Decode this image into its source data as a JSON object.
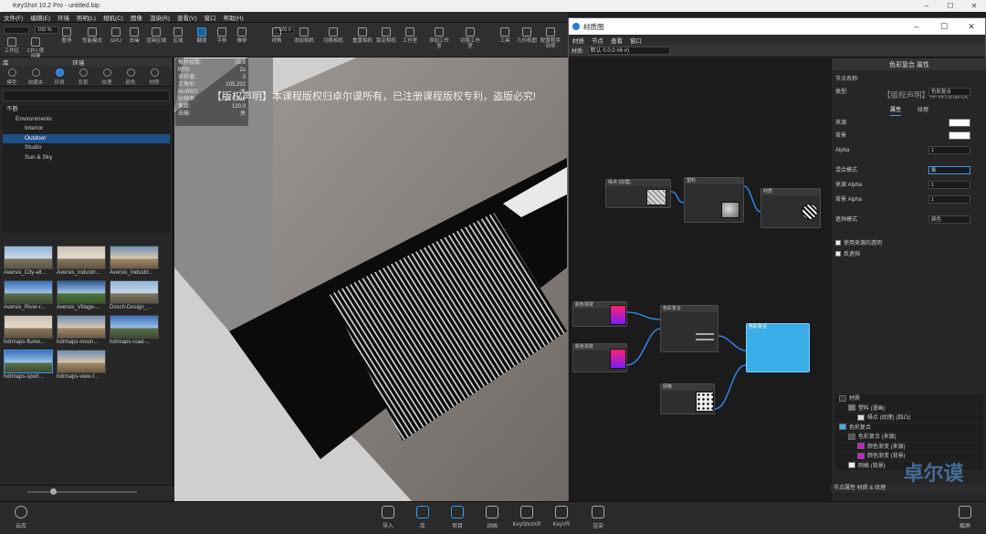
{
  "app": {
    "title": "KeyShot 10.2 Pro - untitled.bip",
    "window_controls": [
      "–",
      "☐",
      "✕"
    ]
  },
  "menubar": [
    "文件(F)",
    "编辑(E)",
    "环境",
    "照明(L)",
    "相机(C)",
    "图像",
    "渲染(R)",
    "查看(V)",
    "窗口",
    "帮助(H)"
  ],
  "toolbar": {
    "buttons": [
      {
        "label": "工作区",
        "active": false
      },
      {
        "label": "CPU 使用量",
        "active": false
      },
      {
        "label": "暂停",
        "active": false
      },
      {
        "label": "性能模式",
        "active": false
      },
      {
        "label": "GPU",
        "active": false
      },
      {
        "label": "去噪",
        "active": false
      },
      {
        "label": "渲染区域",
        "active": false
      },
      {
        "label": "区域",
        "active": false
      },
      {
        "label": "翻滚",
        "active": true
      },
      {
        "label": "平移",
        "active": false
      },
      {
        "label": "推移",
        "active": false
      },
      {
        "label": "视角",
        "active": false
      },
      {
        "label": "添加相机",
        "active": false
      },
      {
        "label": "切换相机",
        "active": false
      },
      {
        "label": "重置相机",
        "active": false
      },
      {
        "label": "锁定相机",
        "active": false
      },
      {
        "label": "工作室",
        "active": false
      },
      {
        "label": "添加工作室",
        "active": false
      },
      {
        "label": "切换工作室",
        "active": false
      },
      {
        "label": "工具",
        "active": false
      },
      {
        "label": "几何视图",
        "active": false
      },
      {
        "label": "配置程序向导",
        "active": false
      }
    ],
    "zoom_value": "100 %",
    "fov_value": "120.0"
  },
  "leftpanel": {
    "header": "库",
    "header2": "环境",
    "tabs": [
      "模型",
      "收藏夹",
      "环境",
      "背景",
      "纹理",
      "颜色",
      "材质"
    ],
    "active_tab": "环境",
    "tree": [
      {
        "label": "不断",
        "indent": 0,
        "selected": false
      },
      {
        "label": "Environments",
        "indent": 1,
        "selected": false
      },
      {
        "label": "Interior",
        "indent": 2,
        "selected": false
      },
      {
        "label": "Outdoor",
        "indent": 2,
        "selected": true
      },
      {
        "label": "Studio",
        "indent": 2,
        "selected": false
      },
      {
        "label": "Sun & Sky",
        "indent": 2,
        "selected": false
      }
    ],
    "thumbnails": [
      {
        "name": "Aversis_City-alt...",
        "style": "sky1"
      },
      {
        "name": "Aversis_Industri...",
        "style": "sky3"
      },
      {
        "name": "Aversis_Industri...",
        "style": "sky5"
      },
      {
        "name": "Aversis_River-r...",
        "style": "sky2"
      },
      {
        "name": "Aversis_Village-...",
        "style": "sky4"
      },
      {
        "name": "Dosch-Design_...",
        "style": "sky1"
      },
      {
        "name": "hdrmaps-flume...",
        "style": "sky3"
      },
      {
        "name": "hdrmaps-moun...",
        "style": "sky5"
      },
      {
        "name": "hdrmaps-road-...",
        "style": "sky2"
      },
      {
        "name": "hdrmaps-sport...",
        "style": "sky2"
      },
      {
        "name": "hdrmaps-view-f...",
        "style": "sky5"
      }
    ]
  },
  "hud": [
    {
      "k": "每秒帧数:",
      "v": "35.9"
    },
    {
      "k": "时间:",
      "v": "2s"
    },
    {
      "k": "采样值:",
      "v": "3"
    },
    {
      "k": "三角形:",
      "v": "105,232"
    },
    {
      "k": "NURBS:",
      "v": "关"
    },
    {
      "k": "分辨率:",
      "v": "720 x 540"
    },
    {
      "k": "焦距:",
      "v": "120.0"
    },
    {
      "k": "去噪:",
      "v": "关"
    }
  ],
  "viewport": {
    "watermark": "【版权声明】本课程版权归卓尔谟所有，已注册课程版权专利，盗版必究!"
  },
  "bottombar": {
    "left_label": "云库",
    "buttons": [
      {
        "label": "导入",
        "active": false
      },
      {
        "label": "库",
        "active": true
      },
      {
        "label": "项目",
        "active": true
      },
      {
        "label": "动画",
        "active": false
      },
      {
        "label": "KeyShotXR",
        "active": false
      },
      {
        "label": "KeyVR",
        "active": false
      },
      {
        "label": "渲染",
        "active": false
      }
    ],
    "right_label": "截屏"
  },
  "material_window": {
    "title": "材质图",
    "menu": [
      "材质",
      "节点",
      "查看",
      "窗口"
    ],
    "material_label": "材质:",
    "material_value": "默认 0.0.0 #6 #)",
    "nodes": [
      {
        "title": "噪点 (纹理)",
        "selected": false
      },
      {
        "title": "塑料",
        "selected": false
      },
      {
        "title": "材质",
        "selected": false
      },
      {
        "title": "颜色渐变",
        "selected": false
      },
      {
        "title": "颜色渐变",
        "selected": false
      },
      {
        "title": "色彩复合",
        "selected": false
      },
      {
        "title": "色彩复合",
        "selected": true
      },
      {
        "title": "网格",
        "selected": false
      }
    ],
    "props_header": "色彩复合 属性",
    "props_watermark": "【版权声明】本课程版权",
    "node_name_label": "节点名称:",
    "type_label": "类型:",
    "type_value": "色彩复合",
    "sub_tabs": [
      "属性",
      "纹理"
    ],
    "rows": [
      {
        "label": "来源",
        "value": "",
        "swatch": true
      },
      {
        "label": "背景",
        "value": "",
        "swatch": true
      },
      {
        "label": "Alpha",
        "value": "1",
        "swatch": false
      },
      {
        "label": "混合模式",
        "value": "乘",
        "swatch": false
      },
      {
        "label": "来源 Alpha",
        "value": "1",
        "swatch": false
      },
      {
        "label": "背景 Alpha",
        "value": "1",
        "swatch": false
      },
      {
        "label": "遮挡模式",
        "value": "颜色",
        "swatch": false
      }
    ],
    "checkboxes": [
      "使用来源的透明",
      "反遮挡"
    ],
    "material_tree": [
      {
        "label": "材质",
        "color": "#3a3a3a",
        "indent": 0
      },
      {
        "label": "塑料 (漫画)",
        "color": "#777777",
        "indent": 1
      },
      {
        "label": "噪点 (纹理) (四凸)",
        "color": "#dddddd",
        "indent": 2
      },
      {
        "label": "色彩复合",
        "color": "#3aaee8",
        "indent": 0
      },
      {
        "label": "色彩复合 (来源)",
        "color": "#555555",
        "indent": 1
      },
      {
        "label": "颜色渐变 (来源)",
        "color": "#d21ad2",
        "indent": 2
      },
      {
        "label": "颜色渐变 (背景)",
        "color": "#d21ad2",
        "indent": 2
      },
      {
        "label": "网格 (背景)",
        "color": "#eeeeee",
        "indent": 1
      }
    ],
    "status": "节点属性    材质 & 纹理"
  },
  "stamp_text": "卓尔谟",
  "colors": {
    "accent": "#2b7cd3",
    "node_selected": "#3aaee8",
    "gradient_start": "#ff1f6a",
    "gradient_end": "#7a1fff"
  }
}
